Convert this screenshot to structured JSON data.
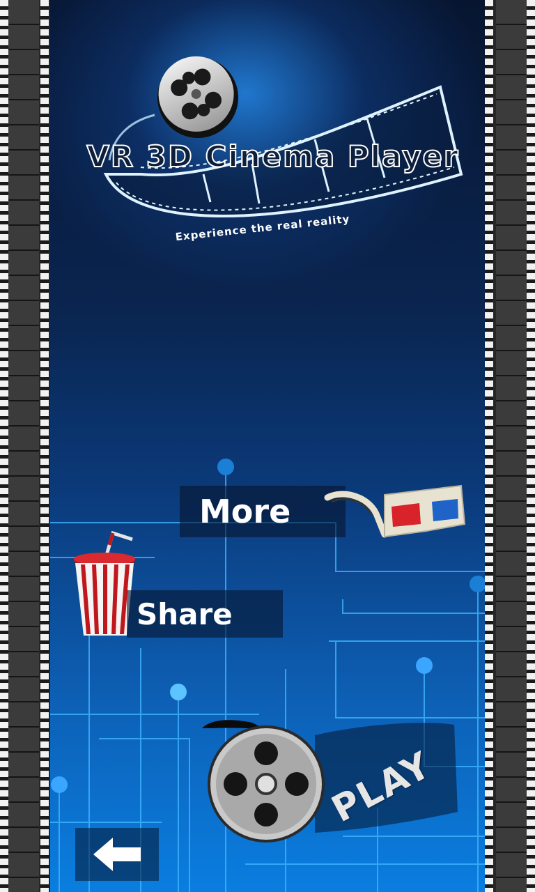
{
  "header": {
    "title": "VR 3D Cinema Player",
    "tagline": "Experience the real reality"
  },
  "menu": {
    "more_label": "More",
    "share_label": "Share",
    "play_label": "PLAY"
  },
  "icons": {
    "film_reel": "film-reel-icon",
    "film_strip": "film-strip-icon",
    "glasses": "3d-glasses-icon",
    "cup": "soda-cup-icon",
    "back": "back-arrow-icon"
  },
  "colors": {
    "background_top": "#071530",
    "background_bottom": "#0a7ee0",
    "circuit": "#3fb4ff",
    "glasses_left_lens": "#d8232a",
    "glasses_right_lens": "#1f63c8",
    "cup_stripe": "#c0171c"
  }
}
